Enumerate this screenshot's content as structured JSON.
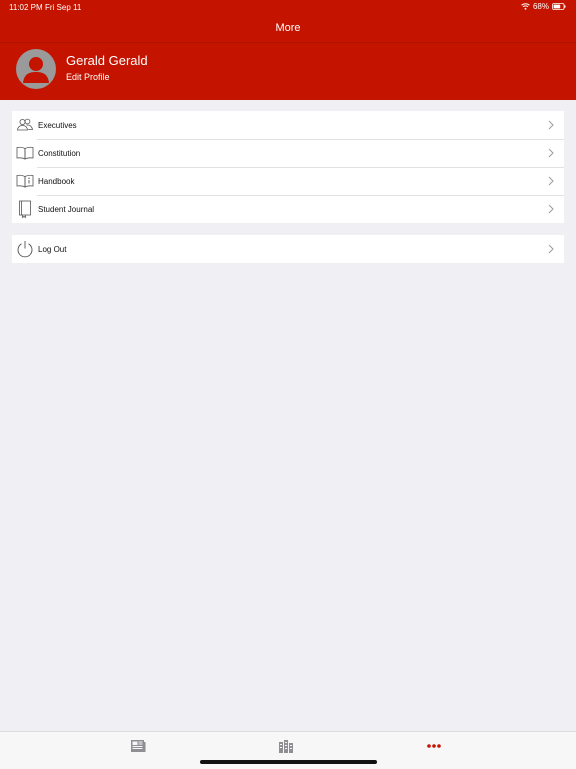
{
  "status": {
    "time": "11:02 PM",
    "date": "Fri Sep 11",
    "battery": "68%"
  },
  "nav": {
    "title": "More"
  },
  "profile": {
    "name": "Gerald Gerald",
    "edit_label": "Edit Profile"
  },
  "menu": {
    "items": [
      {
        "label": "Executives",
        "icon": "people-icon"
      },
      {
        "label": "Constitution",
        "icon": "open-book-icon"
      },
      {
        "label": "Handbook",
        "icon": "handbook-icon"
      },
      {
        "label": "Student Journal",
        "icon": "journal-icon"
      }
    ]
  },
  "logout": {
    "label": "Log Out",
    "icon": "power-icon"
  },
  "tabbar": {
    "tabs": [
      {
        "icon": "news-icon",
        "active": false
      },
      {
        "icon": "buildings-icon",
        "active": false
      },
      {
        "icon": "more-dots-icon",
        "active": true
      }
    ]
  },
  "colors": {
    "brand": "#c41400",
    "background": "#efeff4",
    "inactive_icon": "#8e8e93"
  }
}
